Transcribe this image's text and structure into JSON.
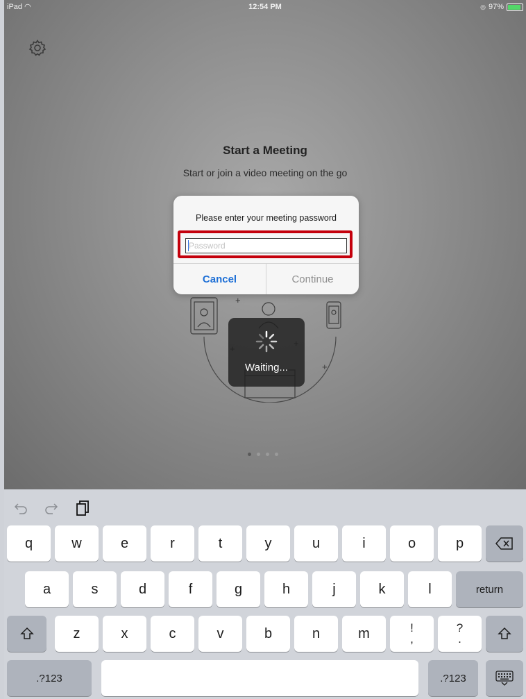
{
  "status_bar": {
    "device": "iPad",
    "time": "12:54 PM",
    "battery": "97%"
  },
  "home": {
    "title": "Start a Meeting",
    "subtitle": "Start or join a video meeting on the go",
    "page_dots": 4,
    "active_dot": 0
  },
  "dialog": {
    "message": "Please enter your meeting password",
    "password_placeholder": "Password",
    "password_value": "",
    "cancel_label": "Cancel",
    "continue_label": "Continue",
    "highlight_color": "#c4000c"
  },
  "hud": {
    "label": "Waiting..."
  },
  "keyboard": {
    "toolbar_icons": [
      "undo-icon",
      "redo-icon",
      "paste-icon"
    ],
    "row1": [
      "q",
      "w",
      "e",
      "r",
      "t",
      "y",
      "u",
      "i",
      "o",
      "p"
    ],
    "row2": [
      "a",
      "s",
      "d",
      "f",
      "g",
      "h",
      "j",
      "k",
      "l"
    ],
    "row3": [
      "z",
      "x",
      "c",
      "v",
      "b",
      "n",
      "m"
    ],
    "punct1_top": "!",
    "punct1_bottom": ",",
    "punct2_top": "?",
    "punct2_bottom": ".",
    "return_label": "return",
    "numbers_label": ".?123",
    "space_label": ""
  },
  "colors": {
    "link_blue": "#1f70d6",
    "screen_gray": "#8e8e8e",
    "keyboard_bg": "#d1d4da"
  }
}
